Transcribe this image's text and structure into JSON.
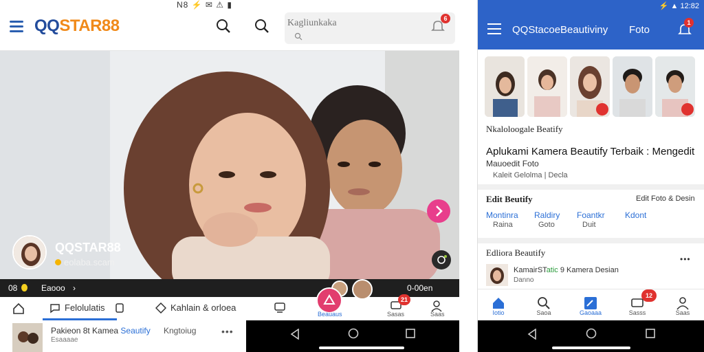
{
  "left": {
    "status_text": "N8 ⚡ ✉ ⚠ ▮",
    "brand_part1": "QQ",
    "brand_part2": "STAR88",
    "search_placeholder": "Kagliunkaka",
    "notif_count": "6",
    "creator_name": "QQSTAR88",
    "creator_sub": "eolaba.scam",
    "strip_left": "08",
    "strip_mid": "Eaooo",
    "strip_arrow": "›",
    "strip_right": "0-00en",
    "tabs": [
      "Felolulatis",
      "Kahlain & orloea"
    ],
    "nav_pink_label": "Beauaus",
    "nav_chat_label": "Sasas",
    "nav_profile_label": "Saas",
    "chat_badge": "21",
    "card_title_part1": "Pakieon 8t Kamea ",
    "card_title_part2": "Seautify",
    "card_tag": "Kngtoiug",
    "card_sub": "Esaaaae",
    "more": "•••",
    "colors": {
      "accent_blue": "#2b6fd6",
      "brand_navy": "#234c9c",
      "brand_orange": "#f08a1a",
      "pink": "#e83e8c"
    }
  },
  "right": {
    "status_text": "⚡ ▲ 12:82",
    "title": "QQStacoeBeautiviny",
    "foto": "Foto",
    "bell_badge": "1",
    "section1_title": "Nkaloloogale Beatify",
    "headline": "Aplukami Kamera Beautify Terbaik : Mengedit",
    "headline2": "Mauoedit Foto",
    "meta": "Kaleit Gelolma | Decla",
    "section2_title": "Edit Beutify",
    "section2_right": "Edit Foto & Desin",
    "links": [
      {
        "label": "Montinra",
        "sub": "Raina"
      },
      {
        "label": "Raldiry",
        "sub": "Goto"
      },
      {
        "label": "Foantkr",
        "sub": "Duit"
      },
      {
        "label": "Kdont",
        "sub": ""
      }
    ],
    "section3_title": "Edliora Beautify",
    "section3_more": "•••",
    "card_name_1": "KamairST",
    "card_name_2": "atic",
    "card_name_3": " 9  Kamera Desian",
    "card_sub": "Danno",
    "card_badge": "12",
    "nav": [
      {
        "label": "Iotio",
        "icon": "home-icon"
      },
      {
        "label": "Saoa",
        "icon": "search-icon"
      },
      {
        "label": "Gaoaaa",
        "icon": "edit-icon"
      },
      {
        "label": "Sasss",
        "icon": "chat-icon"
      },
      {
        "label": "Saas",
        "icon": "profile-icon"
      }
    ],
    "colors": {
      "header_blue": "#2d63c8",
      "badge_red": "#e0322f"
    }
  }
}
